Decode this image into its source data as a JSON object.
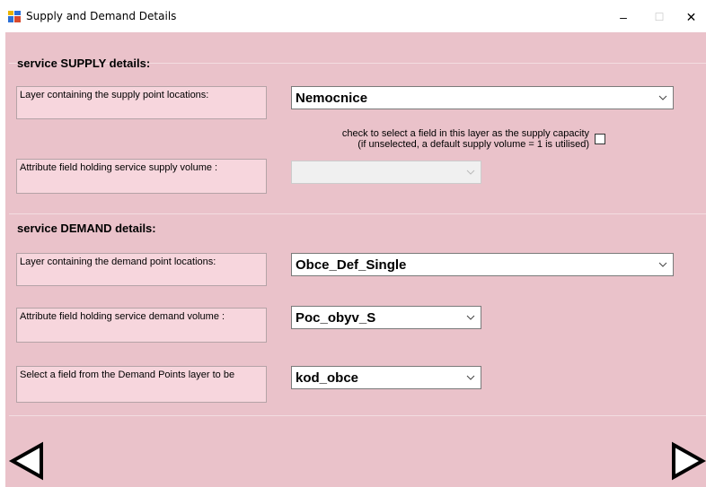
{
  "window": {
    "title": "Supply and Demand Details",
    "controls": {
      "minimize": "–",
      "maximize": "☐",
      "close": "✕"
    }
  },
  "supply": {
    "heading": "service SUPPLY details:",
    "layer_label": "Layer containing the supply point locations:",
    "layer_value": "Nemocnice",
    "capacity_note_line1": "check to select a field in this layer as the supply capacity",
    "capacity_note_line2": "(if unselected, a default supply volume = 1 is utilised)",
    "capacity_checked": false,
    "volume_label": "Attribute field holding service supply volume :",
    "volume_value": ""
  },
  "demand": {
    "heading": "service DEMAND details:",
    "layer_label": "Layer containing the demand point locations:",
    "layer_value": "Obce_Def_Single",
    "volume_label": "Attribute field holding service demand volume :",
    "volume_value": "Poc_obyv_S",
    "id_label": "Select a field from the Demand Points layer to be",
    "id_value": "kod_obce"
  },
  "colors": {
    "background": "#eac2ca",
    "label_bg": "#f7d6dd"
  },
  "icons": {
    "back": "left-triangle-icon",
    "next": "right-triangle-icon"
  }
}
